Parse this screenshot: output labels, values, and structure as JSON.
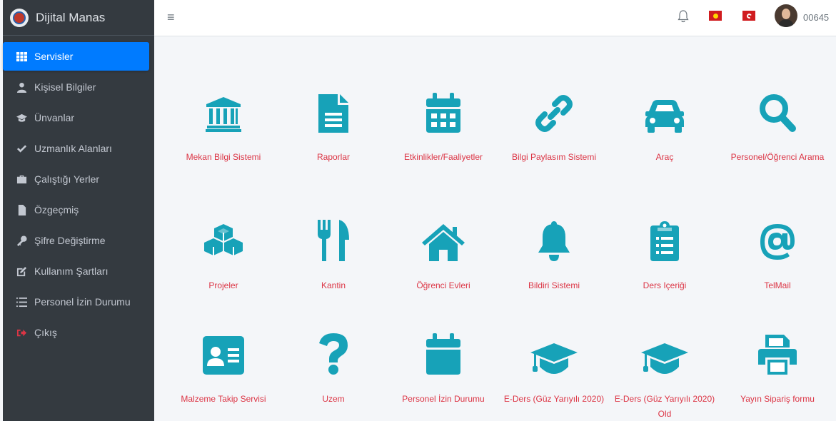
{
  "brand": {
    "title": "Dijital Manas"
  },
  "sidebar": {
    "items": [
      {
        "label": "Servisler",
        "icon": "grid-icon",
        "active": true
      },
      {
        "label": "Kişisel Bilgiler",
        "icon": "user-icon"
      },
      {
        "label": "Ünvanlar",
        "icon": "graduation-cap-icon"
      },
      {
        "label": "Uzmanlık Alanları",
        "icon": "check-icon"
      },
      {
        "label": "Çalıştığı Yerler",
        "icon": "briefcase-icon"
      },
      {
        "label": "Özgeçmiş",
        "icon": "file-icon"
      },
      {
        "label": "Şifre Değiştirme",
        "icon": "key-icon"
      },
      {
        "label": "Kullanım Şartları",
        "icon": "edit-icon"
      },
      {
        "label": "Personel İzin Durumu",
        "icon": "list-icon"
      },
      {
        "label": "Çıkış",
        "icon": "sign-out-icon"
      }
    ]
  },
  "topbar": {
    "menu_icon": "≡",
    "username": "00645"
  },
  "services": [
    {
      "label": "Mekan Bilgi Sistemi",
      "icon": "university-icon"
    },
    {
      "label": "Raporlar",
      "icon": "document-icon"
    },
    {
      "label": "Etkinlikler/Faaliyetler",
      "icon": "calendar-icon"
    },
    {
      "label": "Bilgi Paylasım Sistemi",
      "icon": "link-icon"
    },
    {
      "label": "Araç",
      "icon": "car-icon"
    },
    {
      "label": "Personel/Öğrenci Arama",
      "icon": "search-icon"
    },
    {
      "label": "Projeler",
      "icon": "cubes-icon"
    },
    {
      "label": "Kantin",
      "icon": "utensils-icon"
    },
    {
      "label": "Öğrenci Evleri",
      "icon": "home-icon"
    },
    {
      "label": "Bildiri Sistemi",
      "icon": "bell-icon"
    },
    {
      "label": "Ders Içeriği",
      "icon": "clipboard-list-icon"
    },
    {
      "label": "TelMail",
      "icon": "at-icon"
    },
    {
      "label": "Malzeme Takip Servisi",
      "icon": "id-card-icon"
    },
    {
      "label": "Uzem",
      "icon": "question-icon"
    },
    {
      "label": "Personel İzin Durumu",
      "icon": "calendar-blank-icon"
    },
    {
      "label": "E-Ders (Güz Yarıyılı 2020)",
      "icon": "graduation-cap-icon"
    },
    {
      "label": "E-Ders (Güz Yarıyılı 2020) Old",
      "icon": "graduation-cap-icon"
    },
    {
      "label": "Yayın Sipariş formu",
      "icon": "printer-icon"
    }
  ],
  "colors": {
    "accent": "#007bff",
    "icon": "#17a2b8",
    "label": "#dc3545",
    "sidebar": "#343a40"
  }
}
